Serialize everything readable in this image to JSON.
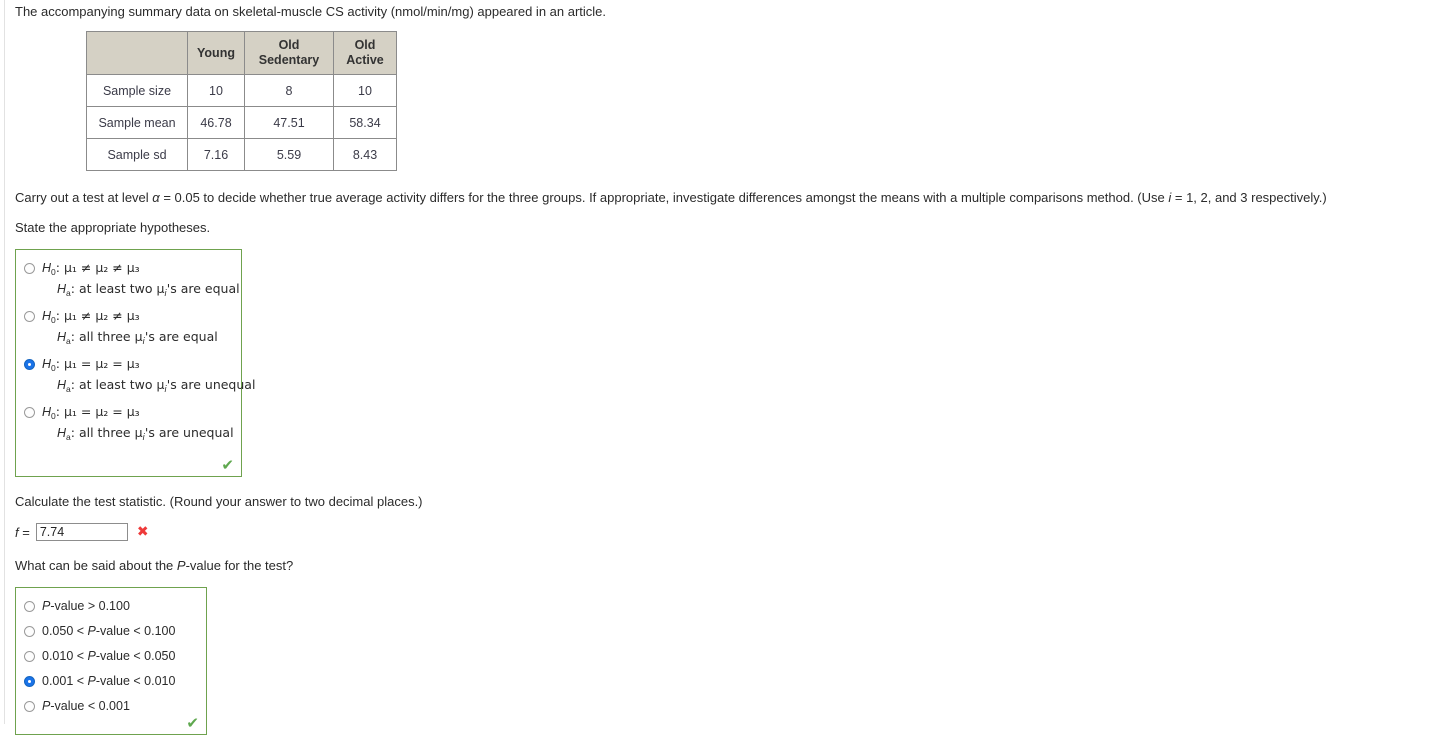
{
  "intro": "The accompanying summary data on skeletal-muscle CS activity (nmol/min/mg) appeared in an article.",
  "table": {
    "corner_label": "",
    "columns": [
      "Young",
      "Old Sedentary",
      "Old Active"
    ],
    "columns_split": [
      {
        "line1": "Young",
        "line2": ""
      },
      {
        "line1": "Old",
        "line2": "Sedentary"
      },
      {
        "line1": "Old",
        "line2": "Active"
      }
    ],
    "rows": [
      {
        "label": "Sample size",
        "values": [
          "10",
          "8",
          "10"
        ]
      },
      {
        "label": "Sample mean",
        "values": [
          "46.78",
          "47.51",
          "58.34"
        ]
      },
      {
        "label": "Sample sd",
        "values": [
          "7.16",
          "5.59",
          "8.43"
        ]
      }
    ]
  },
  "prompt": {
    "part1": "Carry out a test at level ",
    "alpha": "α",
    "part2": " = 0.05 to decide whether true average activity differs for the three groups. If appropriate, investigate differences amongst the means with a multiple comparisons method. (Use ",
    "i": "i",
    "part3": " = 1, 2, and 3 respectively.)",
    "state_hypotheses": "State the appropriate hypotheses."
  },
  "hypotheses": {
    "options": [
      {
        "null_prefix": "H",
        "null_sub": "0",
        "null_body": ": μ₁ ≠ μ₂ ≠ μ₃",
        "alt_prefix": "H",
        "alt_sub": "a",
        "alt_body": ": at least two μᵢ's are equal",
        "selected": false
      },
      {
        "null_prefix": "H",
        "null_sub": "0",
        "null_body": ": μ₁ ≠ μ₂ ≠ μ₃",
        "alt_prefix": "H",
        "alt_sub": "a",
        "alt_body": ": all three μᵢ's are equal",
        "selected": false
      },
      {
        "null_prefix": "H",
        "null_sub": "0",
        "null_body": ": μ₁ = μ₂ = μ₃",
        "alt_prefix": "H",
        "alt_sub": "a",
        "alt_body": ": at least two μᵢ's are unequal",
        "selected": true
      },
      {
        "null_prefix": "H",
        "null_sub": "0",
        "null_body": ": μ₁ = μ₂ = μ₃",
        "alt_prefix": "H",
        "alt_sub": "a",
        "alt_body": ": all three μᵢ's are unequal",
        "selected": false
      }
    ],
    "status_icon": "✔",
    "status": "correct"
  },
  "test_statistic": {
    "question": "Calculate the test statistic. (Round your answer to two decimal places.)",
    "label_var": "f",
    "label_eq": " = ",
    "value": "7.74",
    "placeholder": "",
    "status_icon": "✖",
    "status": "incorrect"
  },
  "pvalue": {
    "question_part1": "What can be said about the ",
    "question_italic": "P",
    "question_part2": "-value for the test?",
    "options": [
      {
        "text": "P-value > 0.100",
        "selected": false
      },
      {
        "text": "0.050 < P-value < 0.100",
        "selected": false
      },
      {
        "text": "0.010 < P-value < 0.050",
        "selected": false
      },
      {
        "text": "0.001 < P-value < 0.010",
        "selected": true
      },
      {
        "text": "P-value < 0.001",
        "selected": false
      }
    ],
    "status_icon": "✔",
    "status": "correct"
  },
  "colors": {
    "table_header_bg": "#d5d1c5",
    "table_border": "#8b8b8b",
    "correct_border": "#6fa24e",
    "check_green": "#5fa84f",
    "x_red": "#ee3a3a",
    "radio_blue": "#1a73e8",
    "text": "#2b2b2b"
  }
}
